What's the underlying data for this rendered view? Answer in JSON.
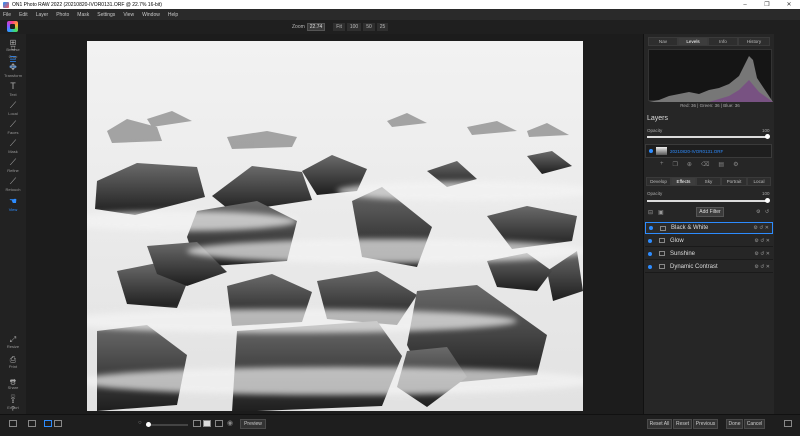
{
  "window": {
    "title": "ON1 Photo RAW 2022 (20210820-IVOR0131.ORF @ 22.7% 16-bit)",
    "minimize": "–",
    "maximize": "❐",
    "close": "✕"
  },
  "menu": [
    "File",
    "Edit",
    "Layer",
    "Photo",
    "Mask",
    "Settings",
    "View",
    "Window",
    "Help"
  ],
  "zoom": {
    "label": "Zoom",
    "value": "22.74",
    "buttons": [
      "Fit",
      "100",
      "50",
      "25"
    ]
  },
  "left_tools": [
    {
      "label": "Crop",
      "icon": "crop-icon"
    },
    {
      "label": "Transform",
      "icon": "transform-icon"
    },
    {
      "label": "Text",
      "icon": "text-icon"
    },
    {
      "label": "Local",
      "icon": "brush-icon"
    },
    {
      "label": "Faces",
      "icon": "faces-icon"
    },
    {
      "label": "Mask",
      "icon": "mask-icon"
    },
    {
      "label": "Refine",
      "icon": "refine-icon"
    },
    {
      "label": "Retouch",
      "icon": "retouch-icon"
    },
    {
      "label": "View",
      "icon": "view-icon"
    }
  ],
  "right_panel": {
    "top_tabs": [
      "Nav",
      "Levels",
      "Info",
      "History"
    ],
    "active_top_tab": "Levels",
    "histogram_readout": "Red: 36  |  Green: 36  |  Blue: 36",
    "layers_title": "Layers",
    "opacity_label": "Opacity",
    "opacity_value": "100",
    "layer_name": "20210820-IVOR0131.ORF",
    "module_tabs": [
      "Develop",
      "Effects",
      "Sky",
      "Portrait",
      "Local"
    ],
    "active_module_tab": "Effects",
    "effects_opacity_label": "Opacity",
    "effects_opacity_value": "100",
    "add_filter": "Add Filter",
    "filters": [
      {
        "name": "Black & White",
        "selected": true
      },
      {
        "name": "Glow",
        "selected": false
      },
      {
        "name": "Sunshine",
        "selected": false
      },
      {
        "name": "Dynamic Contrast",
        "selected": false
      }
    ]
  },
  "modules": [
    {
      "label": "Browse",
      "icon": "browse-icon"
    },
    {
      "label": "Edit",
      "icon": "edit-icon"
    },
    {
      "label": "Resize",
      "icon": "resize-icon"
    },
    {
      "label": "Print",
      "icon": "print-icon"
    },
    {
      "label": "Share",
      "icon": "share-icon"
    },
    {
      "label": "Export",
      "icon": "export-icon"
    }
  ],
  "bottom": {
    "preview": "Preview",
    "reset_all": "Reset All",
    "reset": "Reset",
    "previous": "Previous",
    "done": "Done",
    "cancel": "Cancel"
  },
  "colors": {
    "accent": "#2d8cff",
    "background": "#1b1b1b",
    "panel": "#262626"
  }
}
